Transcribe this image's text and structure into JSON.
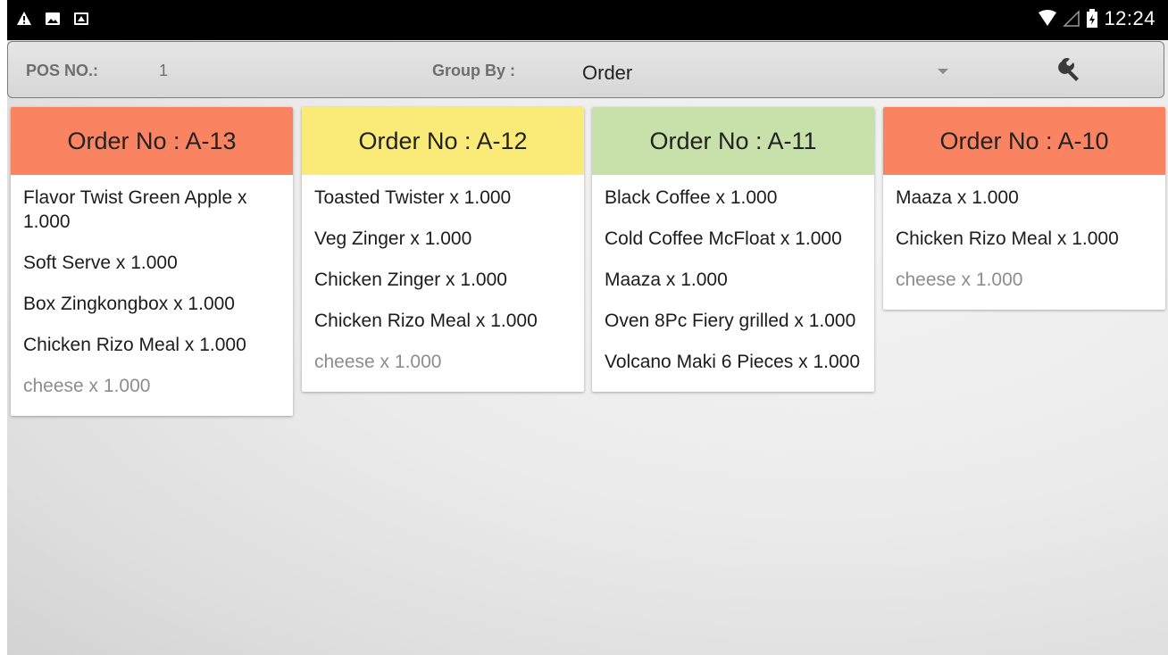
{
  "statusbar": {
    "icons": [
      "warning-icon",
      "image-icon",
      "photo-icon"
    ],
    "time": "12:24"
  },
  "toolbar": {
    "pos_label": "POS NO.:",
    "pos_value": "1",
    "group_label": "Group By :",
    "group_value": "Order",
    "settings_icon": "wrench-icon"
  },
  "colors": {
    "red": "#fa8362",
    "yellow": "#faeb78",
    "green": "#c8e1aa"
  },
  "orders": [
    {
      "title": "Order No : A-13",
      "color": "red",
      "items": [
        {
          "text": "Flavor Twist Green Apple x 1.000",
          "modifier": false
        },
        {
          "text": "Soft Serve x 1.000",
          "modifier": false
        },
        {
          "text": "Box Zingkongbox x 1.000",
          "modifier": false
        },
        {
          "text": "Chicken Rizo Meal x 1.000",
          "modifier": false
        },
        {
          "text": "cheese x 1.000",
          "modifier": true
        }
      ]
    },
    {
      "title": "Order No : A-12",
      "color": "yellow",
      "items": [
        {
          "text": "Toasted Twister x 1.000",
          "modifier": false
        },
        {
          "text": "Veg  Zinger x 1.000",
          "modifier": false
        },
        {
          "text": "Chicken Zinger x 1.000",
          "modifier": false
        },
        {
          "text": "Chicken Rizo Meal x 1.000",
          "modifier": false
        },
        {
          "text": "cheese x 1.000",
          "modifier": true
        }
      ]
    },
    {
      "title": "Order No : A-11",
      "color": "green",
      "items": [
        {
          "text": "Black Coffee x 1.000",
          "modifier": false
        },
        {
          "text": "Cold Coffee McFloat x 1.000",
          "modifier": false
        },
        {
          "text": "Maaza x 1.000",
          "modifier": false
        },
        {
          "text": "Oven 8Pc Fiery grilled x 1.000",
          "modifier": false
        },
        {
          "text": "Volcano Maki 6 Pieces x 1.000",
          "modifier": false
        }
      ]
    },
    {
      "title": "Order No : A-10",
      "color": "red",
      "items": [
        {
          "text": "Maaza x 1.000",
          "modifier": false
        },
        {
          "text": "Chicken Rizo Meal x 1.000",
          "modifier": false
        },
        {
          "text": "cheese x 1.000",
          "modifier": true
        }
      ]
    }
  ]
}
